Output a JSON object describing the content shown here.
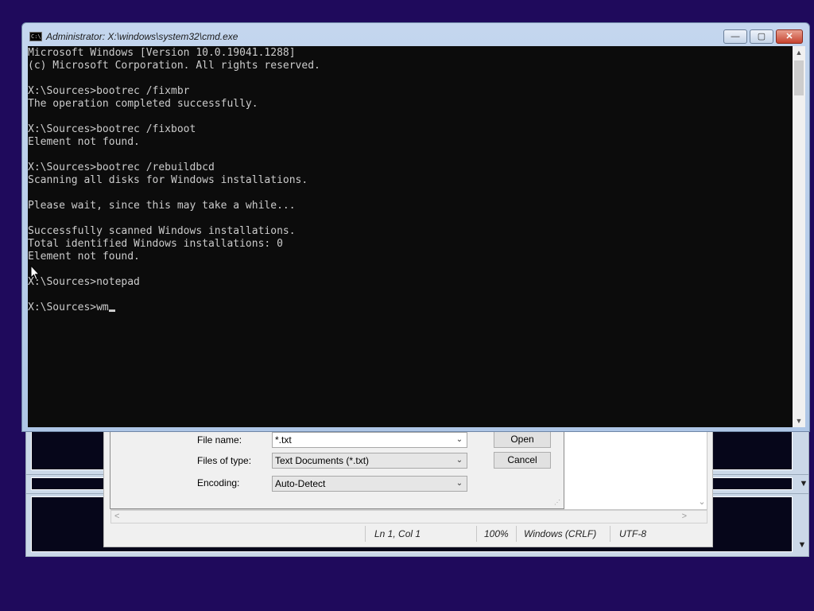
{
  "cmd": {
    "title": "Administrator: X:\\windows\\system32\\cmd.exe",
    "icon_text": "C:\\",
    "lines": [
      "Microsoft Windows [Version 10.0.19041.1288]",
      "(c) Microsoft Corporation. All rights reserved.",
      "",
      "X:\\Sources>bootrec /fixmbr",
      "The operation completed successfully.",
      "",
      "X:\\Sources>bootrec /fixboot",
      "Element not found.",
      "",
      "X:\\Sources>bootrec /rebuildbcd",
      "Scanning all disks for Windows installations.",
      "",
      "Please wait, since this may take a while...",
      "",
      "Successfully scanned Windows installations.",
      "Total identified Windows installations: 0",
      "Element not found.",
      "",
      "X:\\Sources>notepad",
      ""
    ],
    "prompt": "X:\\Sources>",
    "typed": "wm",
    "minimize_glyph": "—",
    "maximize_glyph": "▢",
    "close_glyph": "✕"
  },
  "open_dialog": {
    "file_name_label": "File name:",
    "file_name_value": "*.txt",
    "files_of_type_label": "Files of type:",
    "files_of_type_value": "Text Documents (*.txt)",
    "encoding_label": "Encoding:",
    "encoding_value": "Auto-Detect",
    "open_button": "Open",
    "cancel_button": "Cancel"
  },
  "notepad_status": {
    "position": "Ln 1, Col 1",
    "zoom": "100%",
    "line_ending": "Windows (CRLF)",
    "encoding": "UTF-8"
  },
  "colors": {
    "desktop": "#1f0a5c",
    "console_bg": "#0c0c0c",
    "console_fg": "#cccccc"
  },
  "icons": {
    "chevron": "chevron-down-icon",
    "close": "close-icon",
    "minimize": "minimize-icon",
    "maximize": "maximize-icon"
  }
}
